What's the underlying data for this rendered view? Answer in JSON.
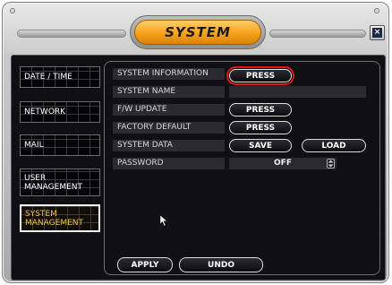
{
  "window": {
    "title": "SYSTEM",
    "close_icon": "close-icon"
  },
  "sidebar": {
    "items": [
      {
        "label": "DATE / TIME",
        "active": false
      },
      {
        "label": "NETWORK",
        "active": false
      },
      {
        "label": "MAIL",
        "active": false
      },
      {
        "label": "USER\nMANAGEMENT",
        "active": false
      },
      {
        "label": "SYSTEM\nMANAGEMENT",
        "active": true
      }
    ]
  },
  "settings": {
    "system_information": {
      "label": "SYSTEM INFORMATION",
      "button": "PRESS"
    },
    "system_name": {
      "label": "SYSTEM NAME",
      "value": ""
    },
    "fw_update": {
      "label": "F/W UPDATE",
      "button": "PRESS"
    },
    "factory_default": {
      "label": "FACTORY DEFAULT",
      "button": "PRESS"
    },
    "system_data": {
      "label": "SYSTEM DATA",
      "save": "SAVE",
      "load": "LOAD"
    },
    "password": {
      "label": "PASSWORD",
      "value": "OFF"
    }
  },
  "footer": {
    "apply": "APPLY",
    "undo": "UNDO"
  },
  "colors": {
    "accent": "#f6a21a",
    "highlight": "#e01616",
    "active_text": "#f4c04a"
  }
}
